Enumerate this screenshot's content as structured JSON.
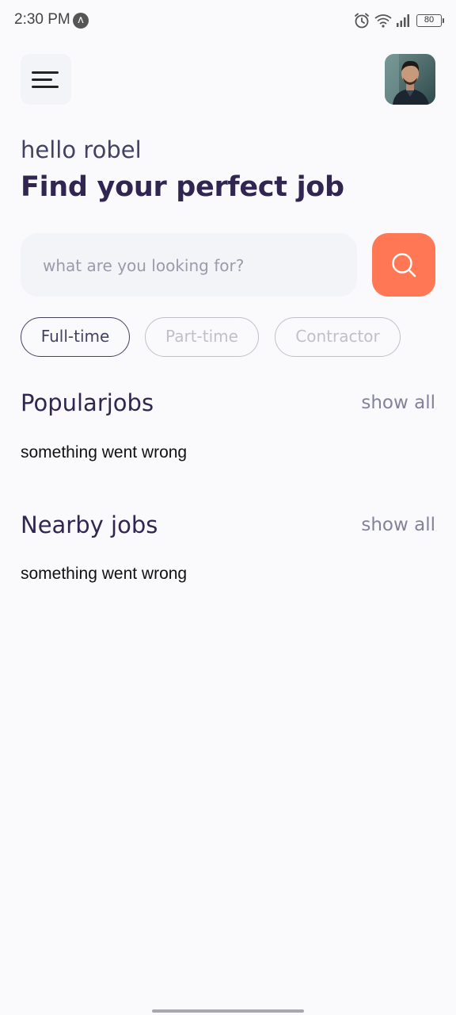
{
  "status_bar": {
    "time": "2:30 PM",
    "app_icon_glyph": "ʌ",
    "battery": "80",
    "icons": [
      "alarm-icon",
      "wifi-icon",
      "signal-icon",
      "battery-icon"
    ]
  },
  "header": {
    "menu_icon": "menu-icon",
    "avatar": "profile-photo"
  },
  "welcome": {
    "greeting": "hello robel",
    "headline": "Find your perfect job"
  },
  "search": {
    "placeholder": "what are you looking for?",
    "value": "",
    "button_icon": "search-icon"
  },
  "job_types": [
    {
      "label": "Full-time",
      "active": true
    },
    {
      "label": "Part-time",
      "active": false
    },
    {
      "label": "Contractor",
      "active": false
    }
  ],
  "popular": {
    "title": "Popularjobs",
    "show_all": "show all",
    "error": "something went wrong"
  },
  "nearby": {
    "title": "Nearby jobs",
    "show_all": "show all",
    "error": "something went wrong"
  },
  "colors": {
    "primary": "#312651",
    "tertiary": "#FF7754",
    "gray": "#83829A",
    "lightWhite": "#FAFAFC",
    "gray2": "#C1C0C8"
  }
}
